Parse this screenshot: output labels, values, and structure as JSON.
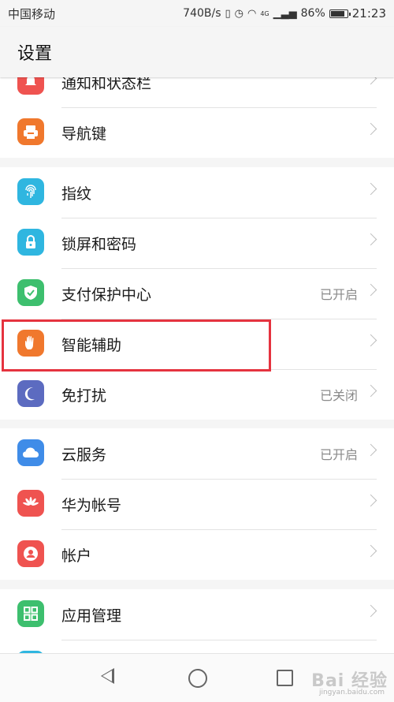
{
  "status_bar": {
    "carrier": "中国移动",
    "speed": "740B/s",
    "network": "4G",
    "battery": "86%",
    "time": "21:23"
  },
  "title": "设置",
  "groups": [
    {
      "items": [
        {
          "label": "通知和状态栏",
          "value": "",
          "icon": "notification-icon",
          "color": "#ef5350"
        },
        {
          "label": "导航键",
          "value": "",
          "icon": "navigation-key-icon",
          "color": "#f0782d"
        }
      ]
    },
    {
      "items": [
        {
          "label": "指纹",
          "value": "",
          "icon": "fingerprint-icon",
          "color": "#2fb6e0"
        },
        {
          "label": "锁屏和密码",
          "value": "",
          "icon": "lock-icon",
          "color": "#2fb6e0"
        },
        {
          "label": "支付保护中心",
          "value": "已开启",
          "icon": "shield-check-icon",
          "color": "#3dbf6e"
        },
        {
          "label": "智能辅助",
          "value": "",
          "icon": "hand-icon",
          "color": "#f0782d"
        },
        {
          "label": "免打扰",
          "value": "已关闭",
          "icon": "moon-icon",
          "color": "#5c6bc0"
        }
      ]
    },
    {
      "items": [
        {
          "label": "云服务",
          "value": "已开启",
          "icon": "cloud-icon",
          "color": "#3f8ce8"
        },
        {
          "label": "华为帐号",
          "value": "",
          "icon": "huawei-logo-icon",
          "color": "#ef5350"
        },
        {
          "label": "帐户",
          "value": "",
          "icon": "account-icon",
          "color": "#ef5350"
        }
      ]
    },
    {
      "items": [
        {
          "label": "应用管理",
          "value": "",
          "icon": "apps-grid-icon",
          "color": "#3dbf6e"
        },
        {
          "label": "",
          "value": "",
          "icon": "partial-item-icon",
          "color": "#2fb6e0"
        }
      ]
    }
  ],
  "watermark": {
    "text": "Bai 经验",
    "sub": "jingyan.baidu.com"
  }
}
